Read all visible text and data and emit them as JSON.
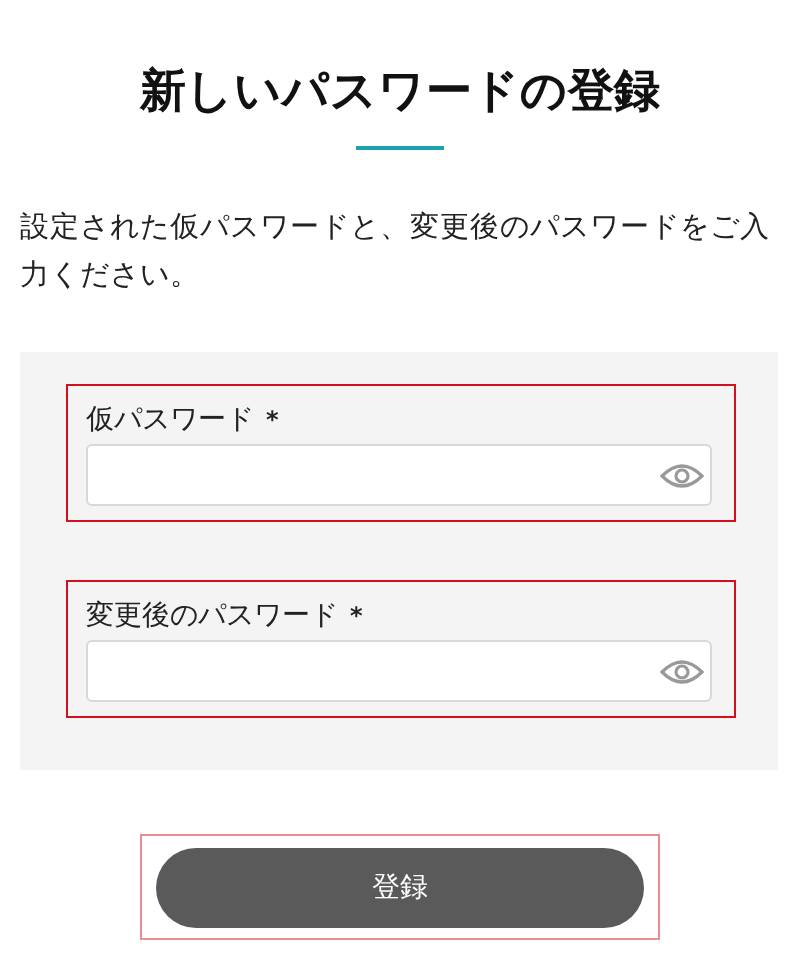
{
  "title": "新しいパスワードの登録",
  "description": "設定された仮パスワードと、変更後のパスワードをご入力ください。",
  "fields": [
    {
      "label": "仮パスワード",
      "required_mark": "*"
    },
    {
      "label": "変更後のパスワード",
      "required_mark": "*"
    }
  ],
  "submit_button": "登録"
}
